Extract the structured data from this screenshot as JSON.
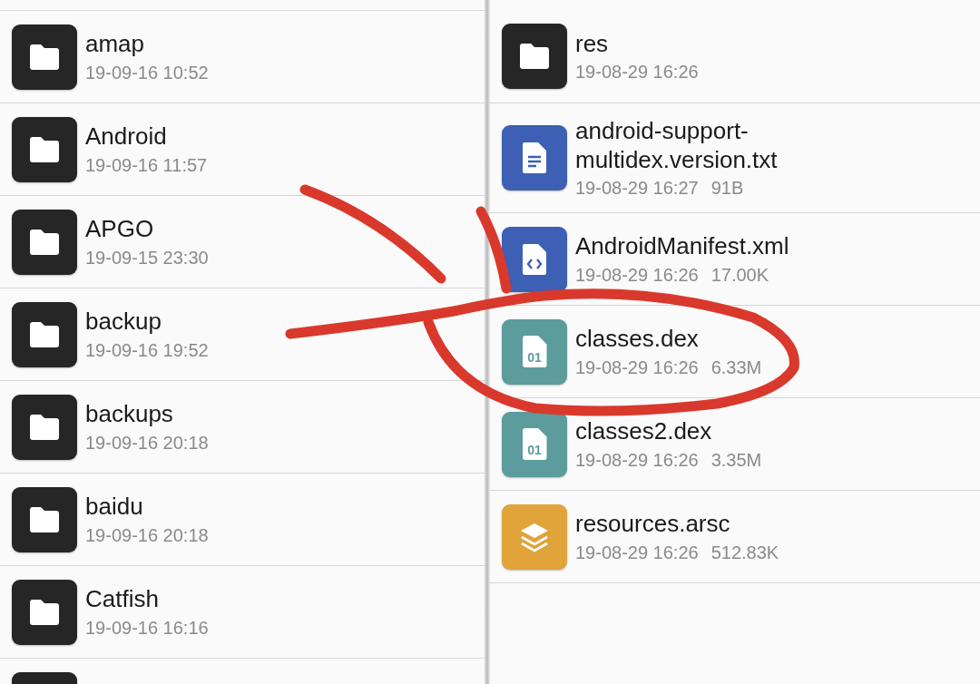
{
  "left_pane": {
    "items": [
      {
        "kind": "folder",
        "name": "amap",
        "date": "19-09-16 10:52"
      },
      {
        "kind": "folder",
        "name": "Android",
        "date": "19-09-16 11:57"
      },
      {
        "kind": "folder",
        "name": "APGO",
        "date": "19-09-15 23:30"
      },
      {
        "kind": "folder",
        "name": "backup",
        "date": "19-09-16 19:52"
      },
      {
        "kind": "folder",
        "name": "backups",
        "date": "19-09-16 20:18"
      },
      {
        "kind": "folder",
        "name": "baidu",
        "date": "19-09-16 20:18"
      },
      {
        "kind": "folder",
        "name": "Catfish",
        "date": "19-09-16 16:16"
      },
      {
        "kind": "folder"
      }
    ]
  },
  "right_pane": {
    "items": [
      {
        "kind": "folder",
        "name": "res",
        "date": "19-08-29 16:26"
      },
      {
        "kind": "text",
        "name": "android-support-multidex.version.txt",
        "date": "19-08-29 16:27",
        "size": "91B"
      },
      {
        "kind": "xml",
        "name": "AndroidManifest.xml",
        "date": "19-08-29 16:26",
        "size": "17.00K"
      },
      {
        "kind": "dex",
        "icon_text": "01",
        "name": "classes.dex",
        "date": "19-08-29 16:26",
        "size": "6.33M"
      },
      {
        "kind": "dex",
        "icon_text": "01",
        "name": "classes2.dex",
        "date": "19-08-29 16:26",
        "size": "3.35M"
      },
      {
        "kind": "archive",
        "name": "resources.arsc",
        "date": "19-08-29 16:26",
        "size": "512.83K"
      }
    ]
  }
}
